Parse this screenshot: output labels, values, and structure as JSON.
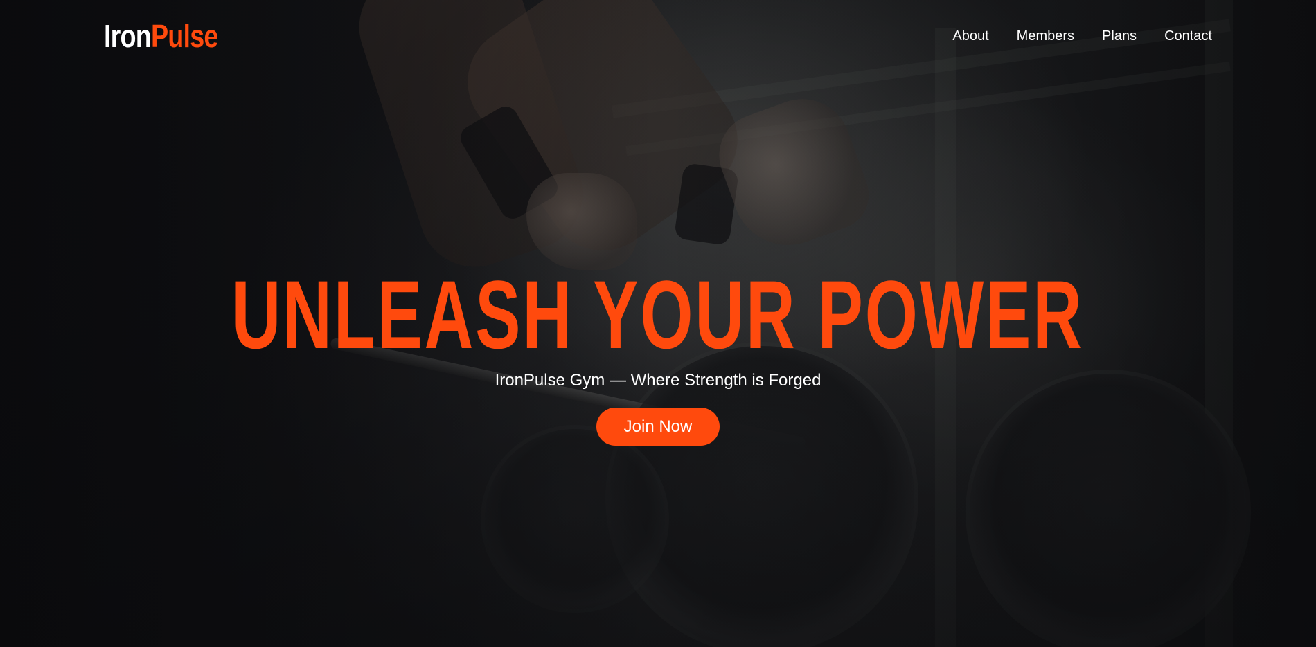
{
  "brand": {
    "name_part1": "Iron",
    "name_part2": "Pulse",
    "accent_color": "#ff4a0d"
  },
  "nav": {
    "items": [
      {
        "label": "About"
      },
      {
        "label": "Members"
      },
      {
        "label": "Plans"
      },
      {
        "label": "Contact"
      }
    ]
  },
  "hero": {
    "headline": "UNLEASH YOUR POWER",
    "tagline": "IronPulse Gym — Where Strength is Forged",
    "cta_label": "Join Now",
    "background": "dark gym photo of athlete with barbell"
  }
}
